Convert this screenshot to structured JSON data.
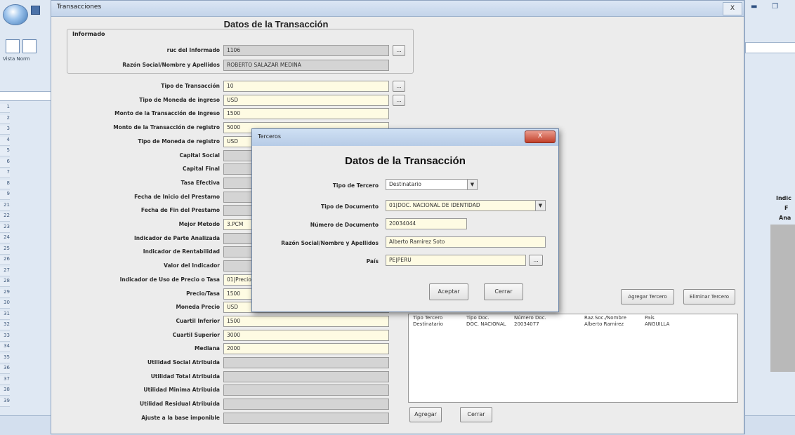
{
  "main_window": {
    "title": "Transacciones",
    "close_label": "X",
    "heading": "Datos de la Transacción",
    "informado": {
      "group_label": "Informado",
      "ruc_label": "ruc del Informado",
      "ruc_value": "1106",
      "razon_label": "Razón Social/Nombre y Apellidos",
      "razon_value": "ROBERTO SALAZAR MEDINA"
    },
    "fields": [
      {
        "label": "Tipo de Transacción",
        "value": "10",
        "style": "yellow",
        "button": true
      },
      {
        "label": "Tipo de Moneda de ingreso",
        "value": "USD",
        "style": "yellow",
        "button": true
      },
      {
        "label": "Monto de la Transacción de ingreso",
        "value": "1500",
        "style": "yellow",
        "button": false
      },
      {
        "label": "Monto de la Transacción de registro",
        "value": "5000",
        "style": "yellow",
        "button": false
      },
      {
        "label": "Tipo de Moneda de registro",
        "value": "USD",
        "style": "yellow",
        "button": false
      },
      {
        "label": "Capital Social",
        "value": "",
        "style": "gray",
        "button": false
      },
      {
        "label": "Capital Final",
        "value": "",
        "style": "gray",
        "button": false
      },
      {
        "label": "Tasa Efectiva",
        "value": "",
        "style": "gray",
        "button": false
      },
      {
        "label": "Fecha de Inicio del Prestamo",
        "value": "",
        "style": "gray",
        "button": false
      },
      {
        "label": "Fecha de Fin del Prestamo",
        "value": "",
        "style": "gray",
        "button": false
      },
      {
        "label": "Mejor Metodo",
        "value": "3.PCM",
        "style": "yellow",
        "button": false
      },
      {
        "label": "Indicador de Parte Analizada",
        "value": "",
        "style": "gray",
        "button": false
      },
      {
        "label": "Indicador de Rentabilidad",
        "value": "",
        "style": "gray",
        "button": false
      },
      {
        "label": "Valor del Indicador",
        "value": "",
        "style": "gray",
        "button": false
      },
      {
        "label": "Indicador de Uso de Precio o Tasa",
        "value": "01|Precio",
        "style": "yellow",
        "button": false
      },
      {
        "label": "Precio/Tasa",
        "value": "1500",
        "style": "yellow",
        "button": false
      },
      {
        "label": "Moneda Precio",
        "value": "USD",
        "style": "yellow",
        "button": false
      },
      {
        "label": "Cuartil Inferior",
        "value": "1500",
        "style": "yellow",
        "button": false
      },
      {
        "label": "Cuartil Superior",
        "value": "3000",
        "style": "yellow",
        "button": false
      },
      {
        "label": "Mediana",
        "value": "2000",
        "style": "yellow",
        "button": false
      },
      {
        "label": "Utilidad Social Atribuida",
        "value": "",
        "style": "gray",
        "button": false
      },
      {
        "label": "Utilidad Total Atribuida",
        "value": "",
        "style": "gray",
        "button": false
      },
      {
        "label": "Utilidad Minima Atribuida",
        "value": "",
        "style": "gray",
        "button": false
      },
      {
        "label": "Utilidad Residual Atribuida",
        "value": "",
        "style": "gray",
        "button": false
      },
      {
        "label": "Ajuste a la base imponible",
        "value": "",
        "style": "gray",
        "button": false
      }
    ],
    "ellipsis": "...",
    "agregar_tercero_label": "Agregar Tercero",
    "eliminar_tercero_label": "Eliminar Tercero",
    "results_headers": [
      "Tipo Tercero",
      "Tipo Doc.",
      "Número Doc.",
      "Raz.Soc./Nombre",
      "País"
    ],
    "results_rows": [
      [
        "Destinatario",
        "DOC. NACIONAL",
        "20034077",
        "Alberto Ramirez",
        "ANGUILLA"
      ]
    ],
    "agregar_label": "Agregar",
    "cerrar_label": "Cerrar"
  },
  "dialog": {
    "title": "Terceros",
    "close_label": "X",
    "heading": "Datos de la Transacción",
    "tipo_tercero_label": "Tipo de Tercero",
    "tipo_tercero_value": "Destinatario",
    "tipo_documento_label": "Tipo de Documento",
    "tipo_documento_value": "01|DOC. NACIONAL DE IDENTIDAD",
    "numero_documento_label": "Número de Documento",
    "numero_documento_value": "20034044",
    "razon_label": "Razón Social/Nombre y Apellidos",
    "razon_value": "Alberto Ramirez Soto",
    "pais_label": "País",
    "pais_value": "PE|PERU",
    "ellipsis": "...",
    "aceptar_label": "Aceptar",
    "cerrar_label": "Cerrar"
  },
  "excel": {
    "rows": [
      "1",
      "2",
      "3",
      "4",
      "5",
      "6",
      "7",
      "8",
      "9",
      "21",
      "22",
      "23",
      "24",
      "25",
      "26",
      "27",
      "28",
      "29",
      "30",
      "31",
      "32",
      "33",
      "34",
      "35",
      "36",
      "37",
      "38",
      "39"
    ],
    "vista_label": "Vista Norm",
    "right_labels": [
      "Indic",
      "F",
      "Ana"
    ]
  }
}
